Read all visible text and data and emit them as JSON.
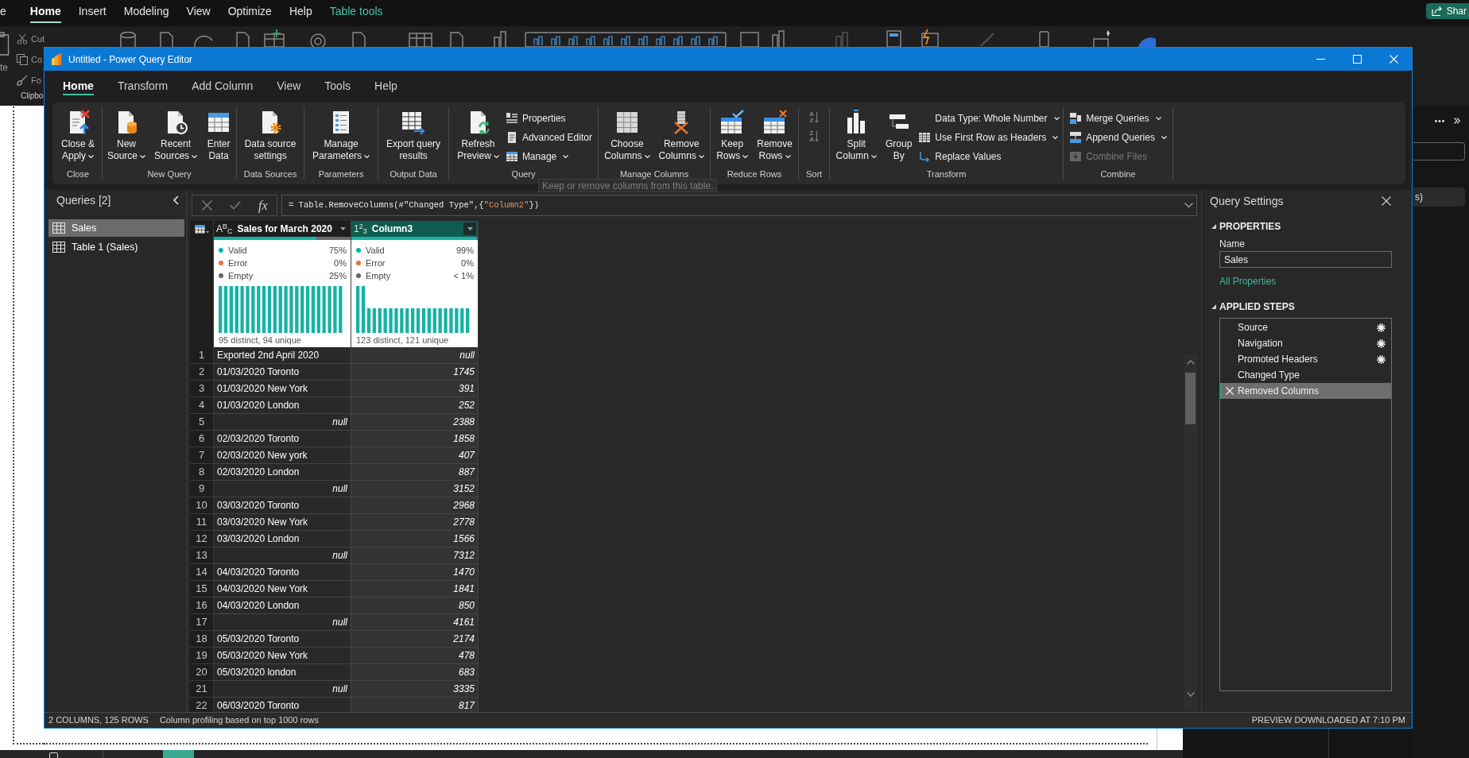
{
  "background_app": {
    "menu_tabs": [
      {
        "label": "e",
        "selected": false,
        "kind": "standard"
      },
      {
        "label": "Home",
        "selected": true,
        "kind": "standard"
      },
      {
        "label": "Insert",
        "selected": false,
        "kind": "standard"
      },
      {
        "label": "Modeling",
        "selected": false,
        "kind": "standard"
      },
      {
        "label": "View",
        "selected": false,
        "kind": "standard"
      },
      {
        "label": "Optimize",
        "selected": false,
        "kind": "standard"
      },
      {
        "label": "Help",
        "selected": false,
        "kind": "standard"
      },
      {
        "label": "Table tools",
        "selected": false,
        "kind": "contextual"
      }
    ],
    "share_button": "Shar",
    "clipboard": {
      "paste_label": "te",
      "items": [
        "Cut",
        "Co",
        "Fo"
      ],
      "group_label": "Clipbo"
    },
    "side_pane": {
      "item": "s)"
    }
  },
  "window": {
    "title": "Untitled - Power Query Editor"
  },
  "tabs": [
    {
      "label": "Home",
      "selected": true
    },
    {
      "label": "Transform",
      "selected": false
    },
    {
      "label": "Add Column",
      "selected": false
    },
    {
      "label": "View",
      "selected": false
    },
    {
      "label": "Tools",
      "selected": false
    },
    {
      "label": "Help",
      "selected": false
    }
  ],
  "ribbon": {
    "groups": [
      {
        "label": "Close",
        "buttons": [
          {
            "kind": "large",
            "lines": [
              "Close &",
              "Apply"
            ],
            "dropdown": true,
            "disabled": false
          }
        ]
      },
      {
        "label": "New Query",
        "buttons": [
          {
            "kind": "large",
            "lines": [
              "New",
              "Source"
            ],
            "dropdown": true,
            "disabled": false
          },
          {
            "kind": "large",
            "lines": [
              "Recent",
              "Sources"
            ],
            "dropdown": true,
            "disabled": false
          },
          {
            "kind": "large",
            "lines": [
              "Enter",
              "Data"
            ],
            "dropdown": false,
            "disabled": false
          }
        ]
      },
      {
        "label": "Data Sources",
        "buttons": [
          {
            "kind": "large",
            "lines": [
              "Data source",
              "settings"
            ],
            "dropdown": false,
            "disabled": false
          }
        ]
      },
      {
        "label": "Parameters",
        "buttons": [
          {
            "kind": "large",
            "lines": [
              "Manage",
              "Parameters"
            ],
            "dropdown": true,
            "disabled": false
          }
        ]
      },
      {
        "label": "Output Data",
        "buttons": [
          {
            "kind": "large",
            "lines": [
              "Export query",
              "results"
            ],
            "dropdown": false,
            "disabled": false
          }
        ]
      },
      {
        "label": "Query",
        "buttons": [
          {
            "kind": "large",
            "lines": [
              "Refresh",
              "Preview"
            ],
            "dropdown": true,
            "disabled": false
          },
          {
            "kind": "small",
            "label": "Properties",
            "dropdown": false,
            "disabled": false
          },
          {
            "kind": "small",
            "label": "Advanced Editor",
            "dropdown": false,
            "disabled": false
          },
          {
            "kind": "small",
            "label": "Manage",
            "dropdown": true,
            "disabled": false
          }
        ]
      },
      {
        "label": "Manage Columns",
        "buttons": [
          {
            "kind": "large",
            "lines": [
              "Choose",
              "Columns"
            ],
            "dropdown": true,
            "disabled": false
          },
          {
            "kind": "large",
            "lines": [
              "Remove",
              "Columns"
            ],
            "dropdown": true,
            "disabled": false
          }
        ]
      },
      {
        "label": "Reduce Rows",
        "buttons": [
          {
            "kind": "large",
            "lines": [
              "Keep",
              "Rows"
            ],
            "dropdown": true,
            "disabled": false
          },
          {
            "kind": "large",
            "lines": [
              "Remove",
              "Rows"
            ],
            "dropdown": true,
            "disabled": false
          }
        ]
      },
      {
        "label": "Sort",
        "buttons": [
          {
            "kind": "sort",
            "glyphs": [
              "A",
              "Z"
            ],
            "disabled": true
          },
          {
            "kind": "sort",
            "glyphs": [
              "Z",
              "A"
            ],
            "disabled": true
          }
        ]
      },
      {
        "label": "Transform",
        "buttons": [
          {
            "kind": "large",
            "lines": [
              "Split",
              "Column"
            ],
            "dropdown": true,
            "disabled": false
          },
          {
            "kind": "large",
            "lines": [
              "Group",
              "By"
            ],
            "dropdown": false,
            "disabled": false
          },
          {
            "kind": "small",
            "label": "Data Type: Whole Number",
            "dropdown": true,
            "disabled": false
          },
          {
            "kind": "small",
            "label": "Use First Row as Headers",
            "dropdown": true,
            "disabled": false
          },
          {
            "kind": "small",
            "label": "Replace Values",
            "dropdown": false,
            "disabled": false
          }
        ]
      },
      {
        "label": "Combine",
        "buttons": [
          {
            "kind": "small",
            "label": "Merge Queries",
            "dropdown": true,
            "disabled": false
          },
          {
            "kind": "small",
            "label": "Append Queries",
            "dropdown": true,
            "disabled": false
          },
          {
            "kind": "small",
            "label": "Combine Files",
            "dropdown": false,
            "disabled": true
          }
        ]
      }
    ]
  },
  "tooltip": "Keep or remove columns from this table.",
  "queries": {
    "title": "Queries [2]",
    "items": [
      {
        "name": "Sales",
        "selected": true
      },
      {
        "name": "Table 1 (Sales)",
        "selected": false
      }
    ]
  },
  "formula_bar": {
    "function_button": "fx",
    "tokens": [
      {
        "text": "= Table.RemoveColumns(#\"Changed Type\",{",
        "kind": "code"
      },
      {
        "text": "\"Column2\"",
        "kind": "string"
      },
      {
        "text": "})",
        "kind": "code"
      }
    ]
  },
  "table": {
    "columns": [
      {
        "type_label": "A$^{B}$$_{C}$",
        "name": "Sales for March 2020",
        "selected": false,
        "quality_bar": {
          "level": 0.75
        },
        "profile": [
          {
            "label": "Valid",
            "value": "75%",
            "color": "#01b8aa"
          },
          {
            "label": "Error",
            "value": "0%",
            "color": "#e8703a"
          },
          {
            "label": "Empty",
            "value": "25%",
            "color": "#666666"
          }
        ],
        "histogram": {
          "kind": "even"
        },
        "summary": "95 distinct, 94 unique"
      },
      {
        "type_label": "1$^{2}$$_{3}$",
        "name": "Column3",
        "selected": true,
        "quality_bar": {
          "level": 0.99
        },
        "profile": [
          {
            "label": "Valid",
            "value": "99%",
            "color": "#01b8aa"
          },
          {
            "label": "Error",
            "value": "0%",
            "color": "#e8703a"
          },
          {
            "label": "Empty",
            "value": "< 1%",
            "color": "#666666"
          }
        ],
        "histogram": {
          "kind": "two_tall"
        },
        "summary": "123 distinct, 121 unique"
      }
    ],
    "rows": [
      {
        "number": "1",
        "cells": [
          {
            "text": "Exported 2nd April 2020",
            "kind": "text"
          },
          {
            "text": "null",
            "kind": "null"
          }
        ]
      },
      {
        "number": "2",
        "cells": [
          {
            "text": "01/03/2020 Toronto",
            "kind": "text"
          },
          {
            "text": "1745",
            "kind": "number"
          }
        ]
      },
      {
        "number": "3",
        "cells": [
          {
            "text": "01/03/2020 New York",
            "kind": "text"
          },
          {
            "text": "391",
            "kind": "number"
          }
        ]
      },
      {
        "number": "4",
        "cells": [
          {
            "text": "01/03/2020 London",
            "kind": "text"
          },
          {
            "text": "252",
            "kind": "number"
          }
        ]
      },
      {
        "number": "5",
        "cells": [
          {
            "text": "null",
            "kind": "null"
          },
          {
            "text": "2388",
            "kind": "number"
          }
        ]
      },
      {
        "number": "6",
        "cells": [
          {
            "text": "02/03/2020 Toronto",
            "kind": "text"
          },
          {
            "text": "1858",
            "kind": "number"
          }
        ]
      },
      {
        "number": "7",
        "cells": [
          {
            "text": "02/03/2020 New york",
            "kind": "text"
          },
          {
            "text": "407",
            "kind": "number"
          }
        ]
      },
      {
        "number": "8",
        "cells": [
          {
            "text": "02/03/2020 London",
            "kind": "text"
          },
          {
            "text": "887",
            "kind": "number"
          }
        ]
      },
      {
        "number": "9",
        "cells": [
          {
            "text": "null",
            "kind": "null"
          },
          {
            "text": "3152",
            "kind": "number"
          }
        ]
      },
      {
        "number": "10",
        "cells": [
          {
            "text": "03/03/2020 Toronto",
            "kind": "text"
          },
          {
            "text": "2968",
            "kind": "number"
          }
        ]
      },
      {
        "number": "11",
        "cells": [
          {
            "text": "03/03/2020 New York",
            "kind": "text"
          },
          {
            "text": "2778",
            "kind": "number"
          }
        ]
      },
      {
        "number": "12",
        "cells": [
          {
            "text": "03/03/2020 London",
            "kind": "text"
          },
          {
            "text": "1566",
            "kind": "number"
          }
        ]
      },
      {
        "number": "13",
        "cells": [
          {
            "text": "null",
            "kind": "null"
          },
          {
            "text": "7312",
            "kind": "number"
          }
        ]
      },
      {
        "number": "14",
        "cells": [
          {
            "text": "04/03/2020 Toronto",
            "kind": "text"
          },
          {
            "text": "1470",
            "kind": "number"
          }
        ]
      },
      {
        "number": "15",
        "cells": [
          {
            "text": "04/03/2020 New York",
            "kind": "text"
          },
          {
            "text": "1841",
            "kind": "number"
          }
        ]
      },
      {
        "number": "16",
        "cells": [
          {
            "text": "04/03/2020 London",
            "kind": "text"
          },
          {
            "text": "850",
            "kind": "number"
          }
        ]
      },
      {
        "number": "17",
        "cells": [
          {
            "text": "null",
            "kind": "null"
          },
          {
            "text": "4161",
            "kind": "number"
          }
        ]
      },
      {
        "number": "18",
        "cells": [
          {
            "text": "05/03/2020 Toronto",
            "kind": "text"
          },
          {
            "text": "2174",
            "kind": "number"
          }
        ]
      },
      {
        "number": "19",
        "cells": [
          {
            "text": "05/03/2020 New York",
            "kind": "text"
          },
          {
            "text": "478",
            "kind": "number"
          }
        ]
      },
      {
        "number": "20",
        "cells": [
          {
            "text": "05/03/2020 london",
            "kind": "text"
          },
          {
            "text": "683",
            "kind": "number"
          }
        ]
      },
      {
        "number": "21",
        "cells": [
          {
            "text": "null",
            "kind": "null"
          },
          {
            "text": "3335",
            "kind": "number"
          }
        ]
      },
      {
        "number": "22",
        "cells": [
          {
            "text": "06/03/2020 Toronto",
            "kind": "text"
          },
          {
            "text": "817",
            "kind": "number"
          }
        ]
      }
    ]
  },
  "query_settings": {
    "title": "Query Settings",
    "properties": {
      "heading": "PROPERTIES",
      "expanded": true,
      "name_label": "Name",
      "name_value": "Sales",
      "link": "All Properties"
    },
    "applied_steps": {
      "heading": "APPLIED STEPS",
      "expanded": true,
      "steps": [
        {
          "name": "Source",
          "has_settings": true,
          "selected": false
        },
        {
          "name": "Navigation",
          "has_settings": true,
          "selected": false
        },
        {
          "name": "Promoted Headers",
          "has_settings": true,
          "selected": false
        },
        {
          "name": "Changed Type",
          "has_settings": false,
          "selected": false
        },
        {
          "name": "Removed Columns",
          "has_settings": false,
          "selected": true
        }
      ]
    }
  },
  "status_bar": {
    "left": [
      "2 COLUMNS, 125 ROWS",
      "Column profiling based on top 1000 rows"
    ],
    "right": "PREVIEW DOWNLOADED AT 7:10 PM"
  }
}
